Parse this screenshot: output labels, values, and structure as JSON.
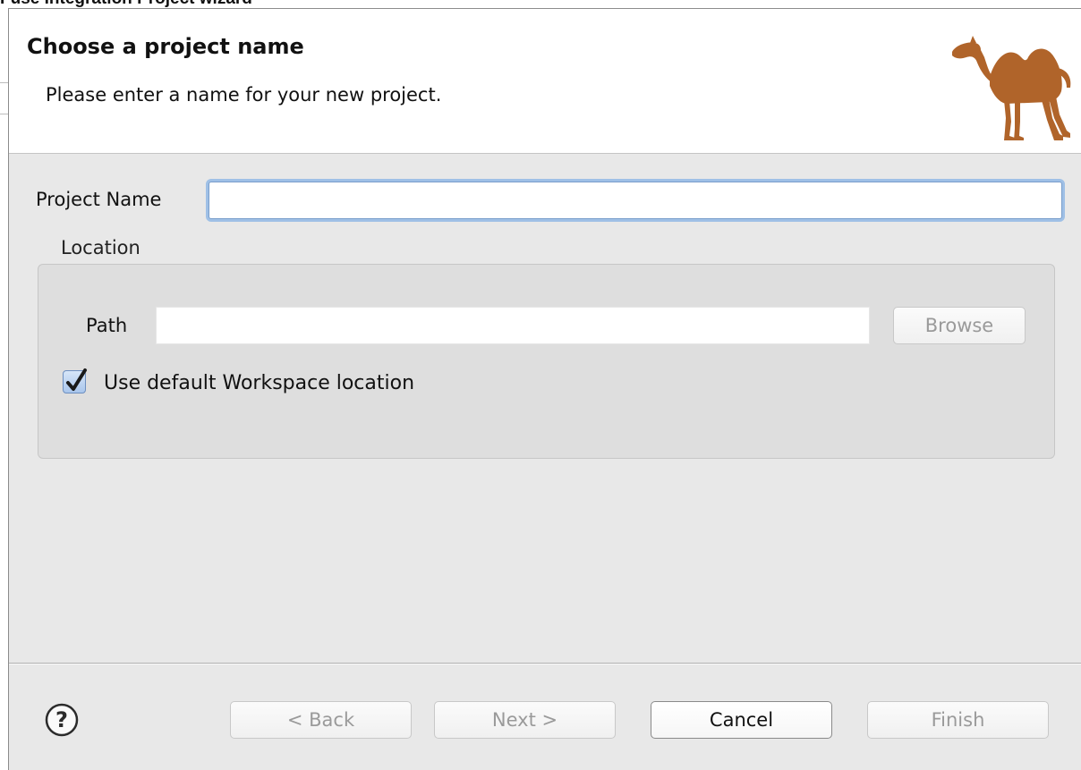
{
  "window": {
    "title": "Fuse Integration Project wizard"
  },
  "banner": {
    "title": "Choose a project name",
    "description": "Please enter a name for your new project.",
    "logo_icon": "camel-icon",
    "logo_color": "#b0642a"
  },
  "form": {
    "project_name_label": "Project Name",
    "project_name_value": "",
    "location_legend": "Location",
    "path_label": "Path",
    "path_value": "",
    "browse_label": "Browse",
    "use_default_label": "Use default Workspace location",
    "use_default_checked": true
  },
  "footer": {
    "help_icon": "question-mark-icon",
    "back_label": "< Back",
    "next_label": "Next >",
    "cancel_label": "Cancel",
    "finish_label": "Finish"
  },
  "colors": {
    "focus_ring": "#9fc0e6",
    "disabled_text": "#9a9a9a"
  }
}
